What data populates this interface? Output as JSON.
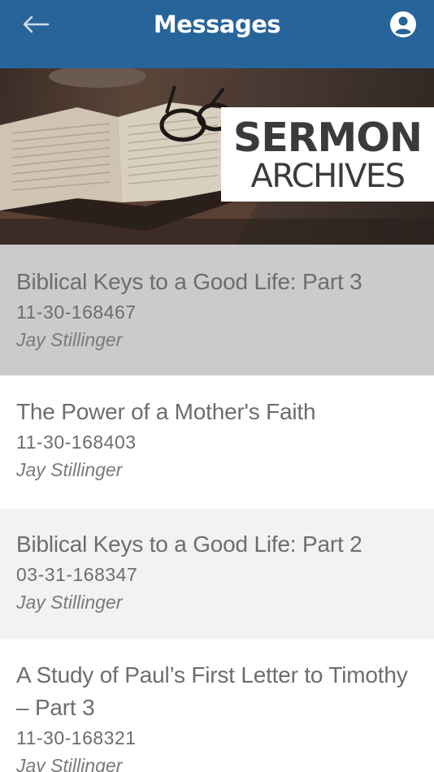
{
  "header": {
    "title": "Messages",
    "back_icon": "arrow-left-icon",
    "profile_icon": "account-circle-icon",
    "bg_color": "#27649a"
  },
  "banner": {
    "line1": "SERMON",
    "line2": "ARCHIVES"
  },
  "messages": [
    {
      "title": "Biblical Keys to a Good Life: Part 3",
      "date": "11-30-168467",
      "author": "Jay Stillinger",
      "state": "selected"
    },
    {
      "title": "The Power of a Mother's Faith",
      "date": "11-30-168403",
      "author": "Jay Stillinger",
      "state": "plain"
    },
    {
      "title": "Biblical Keys to a Good Life: Part 2",
      "date": "03-31-168347",
      "author": "Jay Stillinger",
      "state": "alt"
    },
    {
      "title": "A Study of Paul’s First Letter to Timothy – Part 3",
      "date": "11-30-168321",
      "author": "Jay Stillinger",
      "state": "plain"
    }
  ]
}
